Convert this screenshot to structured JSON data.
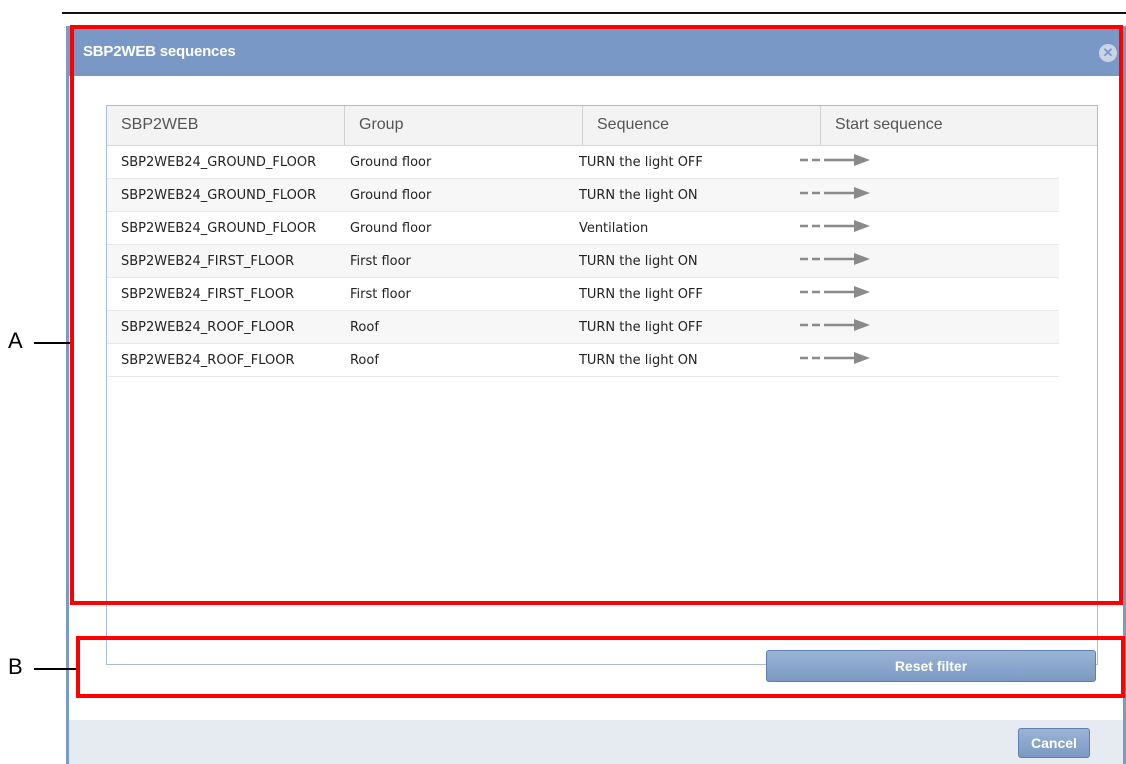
{
  "dialog": {
    "title": "SBP2WEB sequences",
    "close_icon": "close-icon"
  },
  "table": {
    "columns": [
      "SBP2WEB",
      "Group",
      "Sequence",
      "Start sequence"
    ],
    "rows": [
      {
        "sbp2web": "SBP2WEB24_GROUND_FLOOR",
        "group": "Ground floor",
        "sequence": "TURN the light OFF",
        "start": "start-arrow-icon"
      },
      {
        "sbp2web": "SBP2WEB24_GROUND_FLOOR",
        "group": "Ground floor",
        "sequence": "TURN the light ON",
        "start": "start-arrow-icon"
      },
      {
        "sbp2web": "SBP2WEB24_GROUND_FLOOR",
        "group": "Ground floor",
        "sequence": "Ventilation",
        "start": "start-arrow-icon"
      },
      {
        "sbp2web": "SBP2WEB24_FIRST_FLOOR",
        "group": "First floor",
        "sequence": "TURN the light ON",
        "start": "start-arrow-icon"
      },
      {
        "sbp2web": "SBP2WEB24_FIRST_FLOOR",
        "group": "First floor",
        "sequence": "TURN the light OFF",
        "start": "start-arrow-icon"
      },
      {
        "sbp2web": "SBP2WEB24_ROOF_FLOOR",
        "group": "Roof",
        "sequence": "TURN the light OFF",
        "start": "start-arrow-icon"
      },
      {
        "sbp2web": "SBP2WEB24_ROOF_FLOOR",
        "group": "Roof",
        "sequence": "TURN the light ON",
        "start": "start-arrow-icon"
      }
    ]
  },
  "buttons": {
    "reset_filter": "Reset filter",
    "cancel": "Cancel"
  },
  "callouts": {
    "a": "A",
    "b": "B"
  },
  "colors": {
    "titlebar": "#7998c5",
    "callout": "#ff0000",
    "button": "#7b99c3"
  }
}
